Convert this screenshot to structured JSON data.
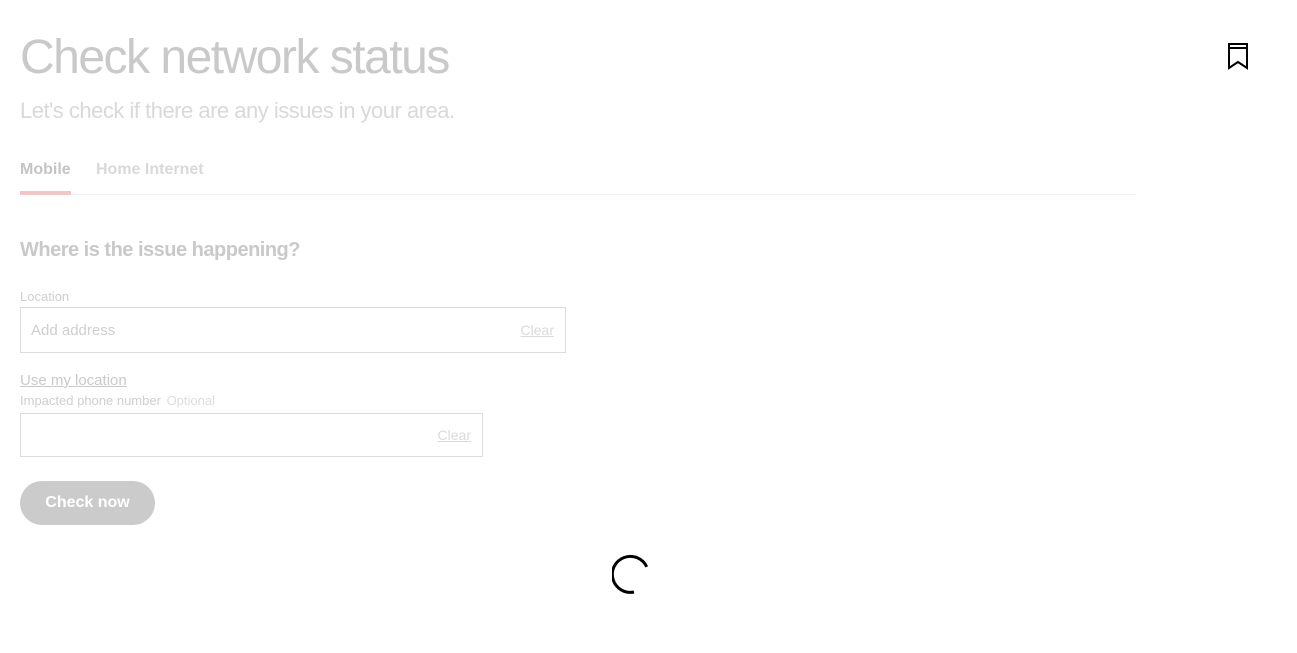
{
  "header": {
    "title": "Check network status",
    "subtitle": "Let's check if there are any issues in your area.",
    "bookmark_icon": "bookmark-icon"
  },
  "tabs": [
    {
      "label": "Mobile",
      "selected": true
    },
    {
      "label": "Home Internet",
      "selected": false
    }
  ],
  "form": {
    "heading": "Where is the issue happening?",
    "location": {
      "label": "Location",
      "placeholder": "Add address",
      "value": "",
      "clear_label": "Clear"
    },
    "use_location_label": "Use my location",
    "phone": {
      "label": "Impacted phone number",
      "optional_label": "Optional",
      "placeholder": "",
      "value": "",
      "clear_label": "Clear"
    },
    "submit_label": "Check now"
  },
  "colors": {
    "tab_indicator": "#f6c4c4",
    "button_bg": "#cbcbcb",
    "spinner": "#000000"
  },
  "spinner_icon": "loading-spinner-icon"
}
